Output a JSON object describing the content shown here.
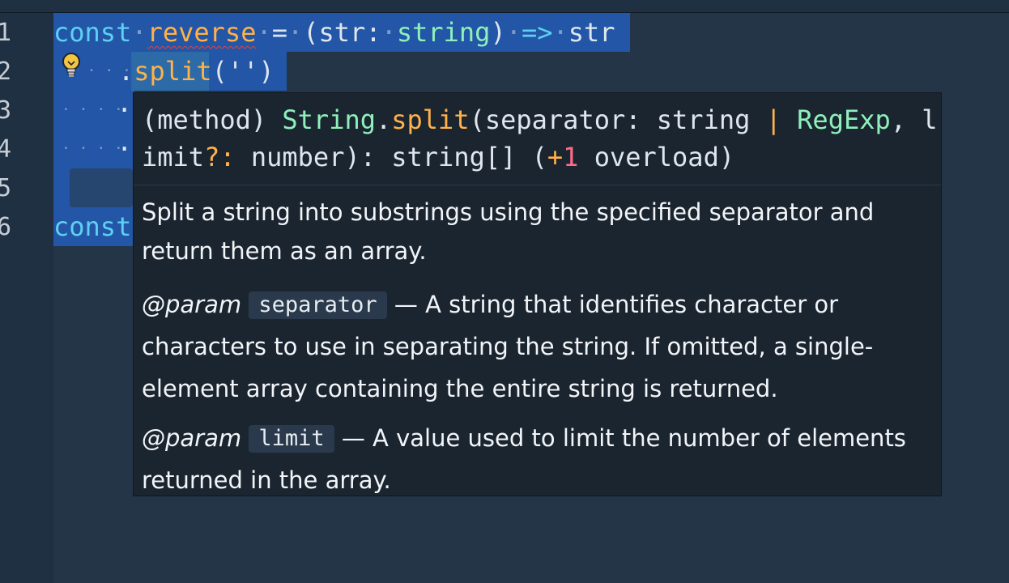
{
  "gutter": {
    "line_numbers": [
      "1",
      "2",
      "3",
      "4",
      "5",
      "6"
    ]
  },
  "code": {
    "line1": {
      "keyword": "const",
      "name": "reverse",
      "eq": "=",
      "open": "(",
      "param": "str",
      "colon": ":",
      "type": "string",
      "close": ")",
      "arrow": "=>",
      "body": "str"
    },
    "line2": {
      "dot": ".",
      "method": "split",
      "args": "('')"
    },
    "line3": {
      "dot": "·"
    },
    "line4": {
      "dot": "·"
    },
    "line6": {
      "keyword": "const"
    }
  },
  "lightbulb": {
    "icon": "lightbulb-icon",
    "color": "#f5c542"
  },
  "hover": {
    "signature": {
      "prefix": "(method) ",
      "class_name": "String",
      "dot": ".",
      "method": "split",
      "open": "(separator: string ",
      "pipe": "|",
      "regexp": " RegExp",
      "after_regexp": ", l",
      "line2_start": "imit",
      "optional": "?:",
      "line2_mid": " number): string[] (",
      "plus": "+",
      "one": "1",
      "line2_end": " overload)"
    },
    "description": "Split a string into substrings using the specified separator and return them as an array.",
    "params": [
      {
        "tag": "@param",
        "name": "separator",
        "text": "— A string that identifies character or characters to use in separating the string. If omitted, a single-element array containing the entire string is returned."
      },
      {
        "tag": "@param",
        "name": "limit",
        "text": "— A value used to limit the number of elements returned in the array."
      }
    ]
  },
  "colors": {
    "editor_bg": "#1f3043",
    "selection": "#2356a6",
    "keyword": "#5ed0f2",
    "function": "#ffb14a",
    "type": "#8ff0bc",
    "hover_bg": "#1b2530"
  }
}
